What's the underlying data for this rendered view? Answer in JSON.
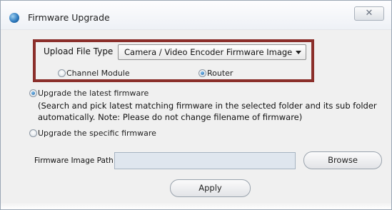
{
  "window": {
    "title": "Firmware Upgrade",
    "close_glyph": "✕",
    "icon": "app-globe-icon"
  },
  "upload": {
    "label": "Upload File Type",
    "selected": "Camera / Video Encoder Firmware Image",
    "options": [
      {
        "label": "Channel Module",
        "checked": false
      },
      {
        "label": "Router",
        "checked": true
      }
    ]
  },
  "mode": {
    "latest_label": "Upgrade the latest firmware",
    "latest_checked": true,
    "latest_desc_line1": "(Search and pick latest matching firmware in the selected folder and its sub folder",
    "latest_desc_line2": "automatically.  Note: Please do not change filename of firmware)",
    "specific_label": "Upgrade the specific firmware",
    "specific_checked": false
  },
  "path": {
    "label": "Firmware Image Path",
    "value": ""
  },
  "buttons": {
    "browse": "Browse",
    "apply": "Apply"
  },
  "colors": {
    "highlight_border": "#8b2f2b",
    "dialog_bg": "#f0f0f0",
    "path_field_bg": "#dfe6ee"
  }
}
